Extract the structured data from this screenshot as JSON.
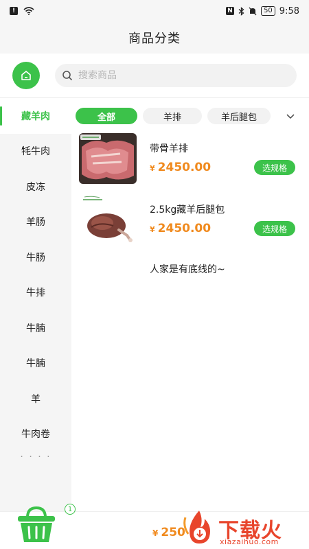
{
  "status_bar": {
    "time": "9:58",
    "battery": "50"
  },
  "header": {
    "title": "商品分类"
  },
  "search": {
    "placeholder": "搜索商品"
  },
  "sidebar": {
    "items": [
      {
        "label": "藏羊肉",
        "active": true
      },
      {
        "label": "牦牛肉"
      },
      {
        "label": "皮冻"
      },
      {
        "label": "羊肠"
      },
      {
        "label": "牛肠"
      },
      {
        "label": "牛排"
      },
      {
        "label": "牛腩"
      },
      {
        "label": "牛腩"
      },
      {
        "label": "羊"
      },
      {
        "label": "牛肉卷"
      }
    ],
    "more": "· · · ·"
  },
  "tabs": [
    {
      "label": "全部",
      "active": true
    },
    {
      "label": "羊排"
    },
    {
      "label": "羊后腿包"
    }
  ],
  "products": [
    {
      "name": "带骨羊排",
      "currency": "¥",
      "price": "2450.00",
      "button": "选规格"
    },
    {
      "name": "2.5kg藏羊后腿包",
      "currency": "¥",
      "price": "2450.00",
      "button": "选规格"
    }
  ],
  "list_end": "人家是有底线的~",
  "cart": {
    "badge": "1",
    "currency": "¥",
    "total": "250"
  },
  "watermark": {
    "text": "下载火",
    "url": "xiazaihuo.com"
  },
  "colors": {
    "accent": "#3cc24a",
    "price": "#f08a1e",
    "watermark": "#e8452c"
  }
}
